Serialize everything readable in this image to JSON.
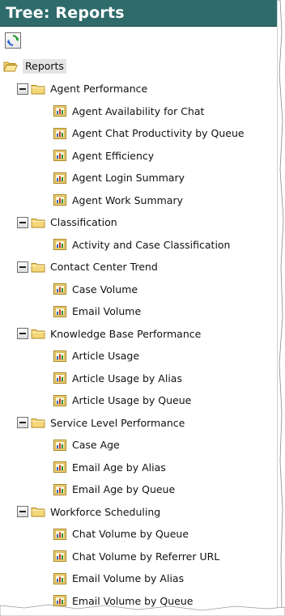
{
  "title": "Tree: Reports",
  "toolbar": {
    "refresh_icon": "refresh-icon"
  },
  "colors": {
    "title_bg": "#2f6b6b",
    "title_text": "#ffffff",
    "folder_fill": "#f5d77a",
    "folder_stroke": "#b08a1e",
    "root_highlight": "#e4e4e4"
  },
  "tree": {
    "root": {
      "label": "Reports",
      "icon": "folder-open-icon"
    },
    "folders": [
      {
        "label": "Agent Performance",
        "icon": "folder-icon",
        "expanded": true,
        "reports": [
          "Agent Availability for Chat",
          "Agent Chat Productivity by Queue",
          "Agent Efficiency",
          "Agent Login Summary",
          "Agent Work Summary"
        ]
      },
      {
        "label": "Classification",
        "icon": "folder-icon",
        "expanded": true,
        "reports": [
          "Activity and Case Classification"
        ]
      },
      {
        "label": "Contact Center Trend",
        "icon": "folder-icon",
        "expanded": true,
        "reports": [
          "Case Volume",
          "Email Volume"
        ]
      },
      {
        "label": "Knowledge Base Performance",
        "icon": "folder-icon",
        "expanded": true,
        "reports": [
          "Article Usage",
          "Article Usage by Alias",
          "Article Usage by Queue"
        ]
      },
      {
        "label": "Service Level Performance",
        "icon": "folder-icon",
        "expanded": true,
        "reports": [
          "Case Age",
          "Email Age by Alias",
          "Email Age by Queue"
        ]
      },
      {
        "label": "Workforce Scheduling",
        "icon": "folder-icon",
        "expanded": true,
        "reports": [
          "Chat Volume by Queue",
          "Chat Volume by Referrer URL",
          "Email Volume by Alias",
          "Email Volume by Queue"
        ]
      }
    ]
  }
}
